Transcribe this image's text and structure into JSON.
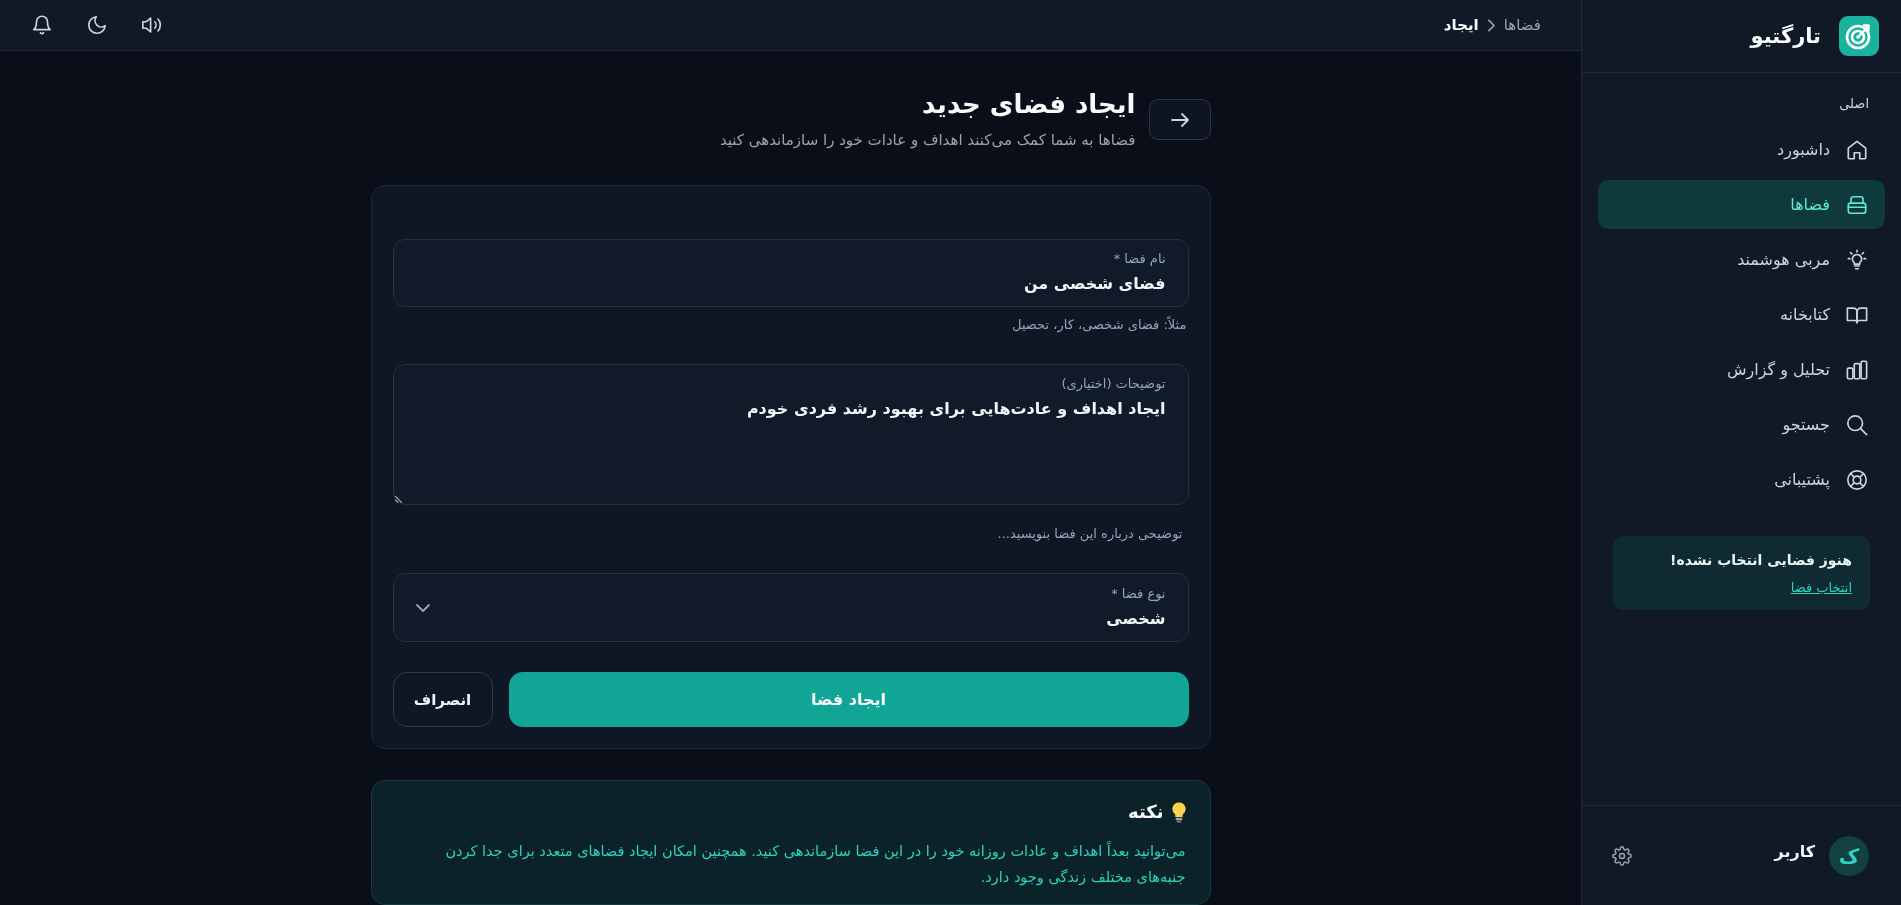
{
  "sidebar": {
    "brand": "تارگتیو",
    "section_label": "اصلی",
    "items": [
      {
        "label": "داشبورد",
        "selected": false
      },
      {
        "label": "فضاها",
        "selected": true
      },
      {
        "label": "مربی هوشمند",
        "selected": false
      },
      {
        "label": "کتابخانه",
        "selected": false
      },
      {
        "label": "تحلیل و گزارش",
        "selected": false
      },
      {
        "label": "جستجو",
        "selected": false
      },
      {
        "label": "پشتیبانی",
        "selected": false
      }
    ],
    "notice": {
      "title": "هنوز فضایی انتخاب نشده!",
      "link": "انتخاب فضا"
    },
    "user": {
      "avatar_letter": "ک",
      "name": "کاربر"
    }
  },
  "header": {
    "breadcrumb": [
      {
        "label": "فضاها",
        "current": false
      },
      {
        "label": "ایجاد",
        "current": true
      }
    ]
  },
  "page": {
    "title": "ایجاد فضای جدید",
    "subtitle": "فضاها به شما کمک می‌کنند اهداف و عادات خود را سازماندهی کنید"
  },
  "form": {
    "fields": [
      {
        "kind": "text",
        "label": "نام فضا *",
        "value": "فضای شخصی من",
        "helper": "مثلاً: فضای شخصی، کار، تحصیل"
      },
      {
        "kind": "textarea",
        "label": "توضیحات (اختیاری)",
        "value": "ایجاد اهداف و عادت‌هایی برای بهبود رشد فردی خودم",
        "helper": "توضیحی درباره این فضا بنویسید..."
      },
      {
        "kind": "select",
        "label": "نوع فضا *",
        "value": "شخصی"
      }
    ],
    "submit": "ایجاد فضا",
    "cancel": "انصراف"
  },
  "tip": {
    "title": "نکته",
    "text": "می‌توانید بعداً اهداف و عادات روزانه خود را در این فضا سازماندهی کنید. همچنین امکان ایجاد فضاهای متعدد برای جدا کردن جنبه‌های مختلف زندگی وجود دارد."
  }
}
